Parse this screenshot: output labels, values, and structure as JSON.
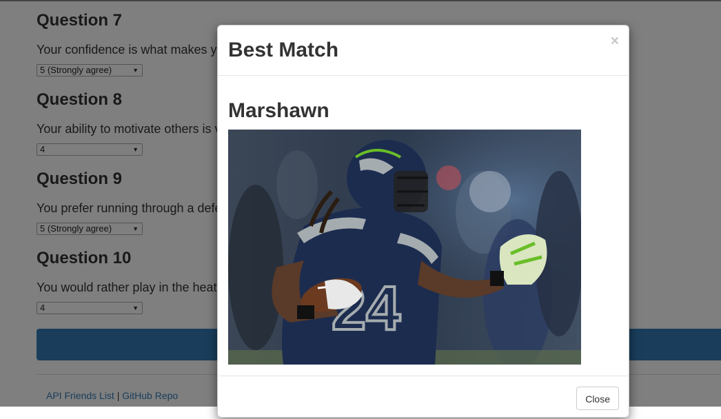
{
  "questions": [
    {
      "title": "Question 7",
      "text": "Your confidence is what makes you",
      "selected": "5 (Strongly agree)"
    },
    {
      "title": "Question 8",
      "text": "Your ability to motivate others is v",
      "selected": "4"
    },
    {
      "title": "Question 9",
      "text": "You prefer running through a defe",
      "selected": "5 (Strongly agree)"
    },
    {
      "title": "Question 10",
      "text": "You would rather play in the heat",
      "selected": "4"
    }
  ],
  "footer": {
    "link1": "API Friends List",
    "separator": "|",
    "link2": "GitHub Repo"
  },
  "modal": {
    "title": "Best Match",
    "close_symbol": "×",
    "match_name": "Marshawn",
    "jersey_number": "24",
    "close_label": "Close"
  },
  "colors": {
    "primary": "#337ab7",
    "seahawks_navy": "#1c2c4f",
    "seahawks_green": "#69be28"
  }
}
